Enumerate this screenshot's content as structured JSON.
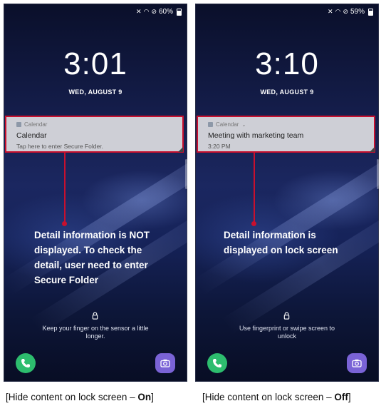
{
  "left_screen": {
    "status": {
      "battery": "60%"
    },
    "time": "3:01",
    "date": "WED, AUGUST 9",
    "notification": {
      "app": "Calendar",
      "title": "Calendar",
      "subtitle": "Tap here to enter Secure Folder."
    },
    "callout": [
      "Detail information is NOT",
      "displayed. To check the",
      "detail, user need to enter",
      "Secure Folder"
    ],
    "unlock_hint": [
      "Keep your finger on the sensor a little",
      "longer."
    ]
  },
  "right_screen": {
    "status": {
      "battery": "59%"
    },
    "time": "3:10",
    "date": "WED, AUGUST 9",
    "notification": {
      "app": "Calendar",
      "title": "Meeting with marketing team",
      "subtitle": "3:20 PM"
    },
    "callout": [
      "Detail information is",
      "displayed on lock screen"
    ],
    "unlock_hint": [
      "Use fingerprint or swipe screen to",
      "unlock"
    ]
  },
  "captions": {
    "left": {
      "prefix": "[Hide content on lock screen – ",
      "state": "On",
      "suffix": "]"
    },
    "right": {
      "prefix": "[Hide content on lock screen – ",
      "state": "Off",
      "suffix": "]"
    }
  },
  "colors": {
    "highlight": "#c8102e",
    "phone_app": "#2dbd6e",
    "camera_app": "#7a63d6"
  },
  "icons": [
    "mute-icon",
    "wifi-icon",
    "no-disturb-icon",
    "battery-icon",
    "calendar-app-icon",
    "lock-icon",
    "phone-icon",
    "camera-icon"
  ]
}
